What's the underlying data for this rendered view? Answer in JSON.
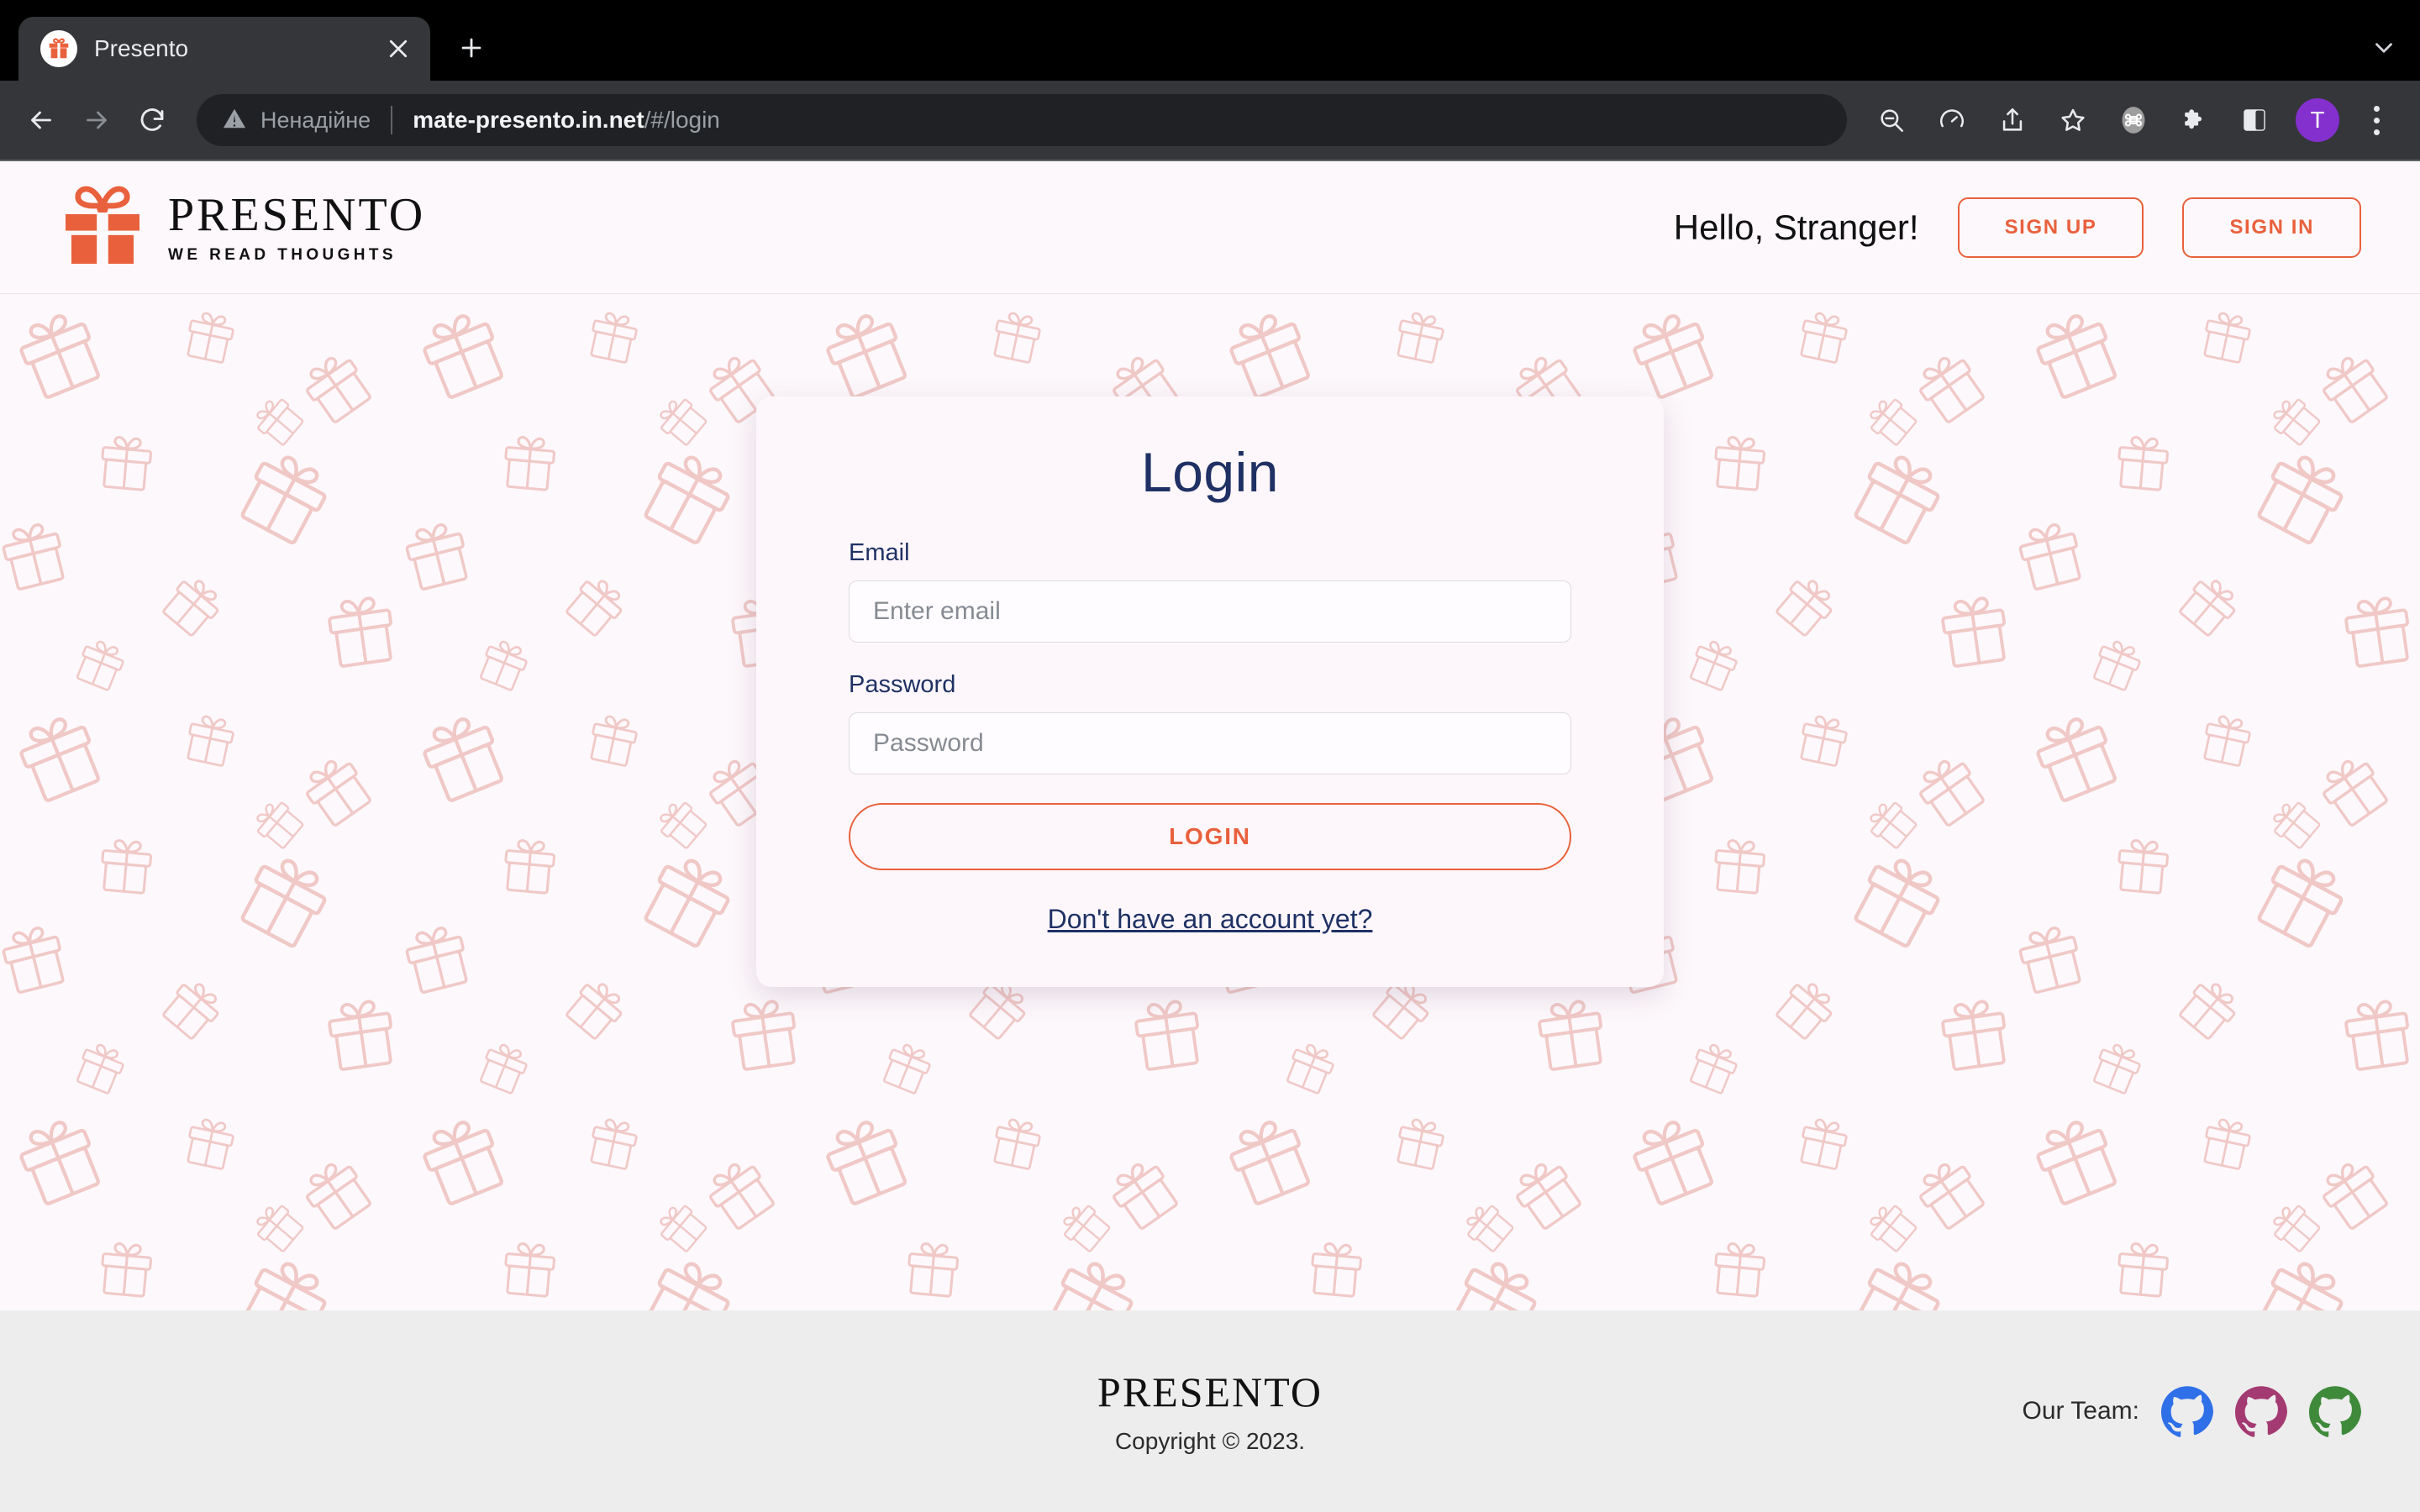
{
  "browser": {
    "tab": {
      "title": "Presento",
      "favicon_icon": "gift-favicon",
      "close_icon": "close-icon"
    },
    "new_tab_icon": "plus-icon",
    "tab_list_icon": "chevron-down-icon",
    "nav": {
      "back_icon": "arrow-back-icon",
      "forward_icon": "arrow-forward-icon",
      "reload_icon": "reload-icon"
    },
    "omnibox": {
      "security_icon": "warning-triangle-icon",
      "security_label": "Ненадійне",
      "url_domain": "mate-presento.in.net",
      "url_path": "/#/login",
      "full_url": "mate-presento.in.net/#/login"
    },
    "toolbar_icons": [
      "zoom-out-icon",
      "performance-icon",
      "share-icon",
      "bookmark-star-icon",
      "command-badge-icon",
      "extensions-puzzle-icon",
      "side-panel-icon"
    ],
    "profile": {
      "initial": "T",
      "color": "#8430ce"
    },
    "menu_icon": "kebab-menu-icon"
  },
  "header": {
    "logo": {
      "icon": "gift-logo-icon",
      "name": "PRESENTO",
      "tagline": "WE READ THOUGHTS"
    },
    "greeting": "Hello, Stranger!",
    "sign_up_label": "SIGN UP",
    "sign_in_label": "SIGN IN"
  },
  "login": {
    "title": "Login",
    "email_label": "Email",
    "email_placeholder": "Enter email",
    "email_value": "",
    "password_label": "Password",
    "password_placeholder": "Password",
    "password_value": "",
    "submit_label": "LOGIN",
    "signup_link": "Don't have an account yet?"
  },
  "footer": {
    "logo": "PRESENTO",
    "copyright": "Copyright © 2023.",
    "team_label": "Our Team:",
    "team_icons": [
      {
        "name": "github-icon-blue",
        "color": "#2f6fe8"
      },
      {
        "name": "github-icon-magenta",
        "color": "#a43a72"
      },
      {
        "name": "github-icon-green",
        "color": "#3f8a3a"
      }
    ]
  },
  "colors": {
    "accent_orange": "#e8613c",
    "navy": "#1f3164",
    "page_bg": "#fdf8fc",
    "pattern_pink": "#f3cfcd",
    "footer_bg": "#ededed"
  }
}
